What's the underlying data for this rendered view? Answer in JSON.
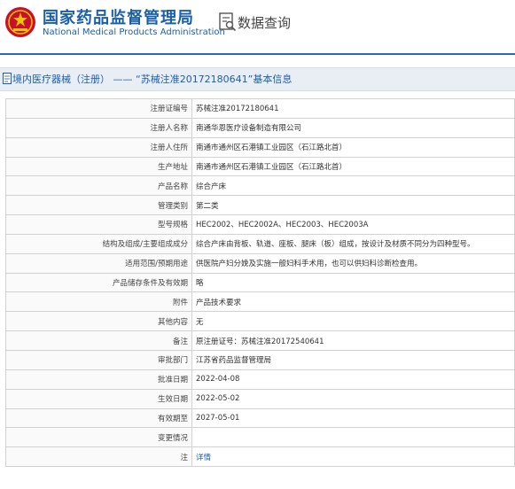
{
  "header": {
    "site_title": "国家药品监督管理局",
    "site_subtitle": "National Medical Products Administration",
    "query_label": "数据查询",
    "accent_color": "#1a5fa8"
  },
  "page": {
    "title": "境内医疗器械（注册） —— “苏械注准20172180641”基本信息"
  },
  "rows": [
    {
      "label": "注册证编号",
      "value": "苏械注准20172180641"
    },
    {
      "label": "注册人名称",
      "value": "南通华恩医疗设备制造有限公司"
    },
    {
      "label": "注册人住所",
      "value": "南通市通州区石港镇工业园区（石江路北首）"
    },
    {
      "label": "生产地址",
      "value": "南通市通州区石港镇工业园区（石江路北首）"
    },
    {
      "label": "产品名称",
      "value": "综合产床"
    },
    {
      "label": "管理类别",
      "value": "第二类"
    },
    {
      "label": "型号规格",
      "value": "HEC2002、HEC2002A、HEC2003、HEC2003A"
    },
    {
      "label": "结构及组成/主要组成成分",
      "value": "综合产床由背板、轨道、座板、腿床（板）组成，按设计及材质不同分为四种型号。"
    },
    {
      "label": "适用范围/预期用途",
      "value": "供医院产妇分娩及实施一般妇科手术用，也可以供妇科诊断检查用。"
    },
    {
      "label": "产品储存条件及有效期",
      "value": "略"
    },
    {
      "label": "附件",
      "value": "产品技术要求"
    },
    {
      "label": "其他内容",
      "value": "无"
    },
    {
      "label": "备注",
      "value": "原注册证号：苏械注准20172540641"
    },
    {
      "label": "审批部门",
      "value": "江苏省药品监督管理局"
    },
    {
      "label": "批准日期",
      "value": "2022-04-08"
    },
    {
      "label": "生效日期",
      "value": "2022-05-02"
    },
    {
      "label": "有效期至",
      "value": "2027-05-01"
    },
    {
      "label": "变更情况",
      "value": ""
    },
    {
      "label": "注",
      "value": "详情",
      "is_link": true
    }
  ]
}
